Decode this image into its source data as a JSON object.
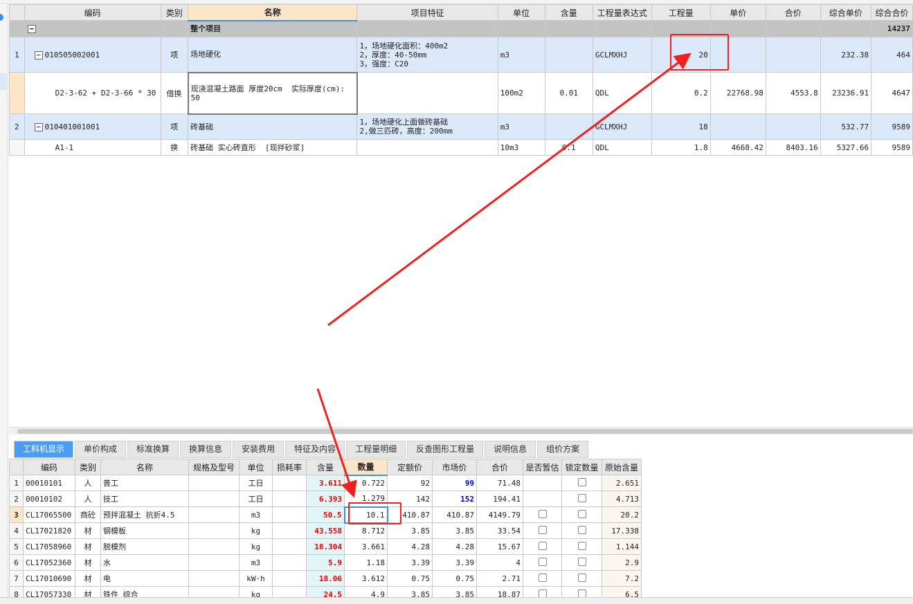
{
  "top_table": {
    "headers": [
      "编码",
      "类别",
      "名称",
      "项目特征",
      "单位",
      "含量",
      "工程量表达式",
      "工程量",
      "单价",
      "合价",
      "综合单价",
      "综合合价"
    ],
    "rows": [
      {
        "no": "",
        "code": "",
        "type": "",
        "name": "整个项目",
        "feature": "",
        "unit": "",
        "content": "",
        "expr": "",
        "qty": "",
        "price": "",
        "total": "",
        "comp_price": "",
        "comp_total": "14237",
        "style": "grey"
      },
      {
        "no": "1",
        "code": "010505002001",
        "type": "项",
        "name": "场地硬化",
        "feature": "1，场地硬化面积：400m2\n2，厚度：40-50mm\n3，强度：C20",
        "unit": "m3",
        "content": "",
        "expr": "GCLMXHJ",
        "qty": "20",
        "price": "",
        "total": "",
        "comp_price": "232.38",
        "comp_total": "464",
        "style": "blue"
      },
      {
        "no": "",
        "code": "D2-3-62 + D2-3-66 * 30",
        "type": "借换",
        "name": "现浇混凝土路面 厚度20cm  实际厚度(cm):\n50",
        "feature": "",
        "unit": "100m2",
        "content": "0.01",
        "expr": "QDL",
        "qty": "0.2",
        "price": "22768.98",
        "total": "4553.8",
        "comp_price": "23236.91",
        "comp_total": "4647",
        "style": "sub"
      },
      {
        "no": "2",
        "code": "010401001001",
        "type": "项",
        "name": "砖基础",
        "feature": "1，场地硬化上面做砖基础\n2,做三匹砖，高度：200mm",
        "unit": "m3",
        "content": "",
        "expr": "GCLMXHJ",
        "qty": "18",
        "price": "",
        "total": "",
        "comp_price": "532.77",
        "comp_total": "9589",
        "style": "blue"
      },
      {
        "no": "",
        "code": "A1-1",
        "type": "换",
        "name": "砖基础 实心砖直形  [现拌砂浆]",
        "feature": "",
        "unit": "10m3",
        "content": "0.1",
        "expr": "QDL",
        "qty": "1.8",
        "price": "4668.42",
        "total": "8403.16",
        "comp_price": "5327.66",
        "comp_total": "9589",
        "style": "sub"
      }
    ]
  },
  "tabs": [
    "工料机显示",
    "单价构成",
    "标准换算",
    "换算信息",
    "安装费用",
    "特征及内容",
    "工程量明细",
    "反查图形工程量",
    "说明信息",
    "组价方案"
  ],
  "bottom_table": {
    "headers": [
      "编码",
      "类别",
      "名称",
      "规格及型号",
      "单位",
      "损耗率",
      "含量",
      "数量",
      "定额价",
      "市场价",
      "合价",
      "是否暂估",
      "锁定数量",
      "原始含量"
    ],
    "rows": [
      {
        "no": "1",
        "code": "00010101",
        "type": "人",
        "name": "普工",
        "spec": "",
        "unit": "工日",
        "loss": "",
        "content": "3.611",
        "qty": "0.722",
        "base": "92",
        "market": "99",
        "total": "71.48",
        "est": false,
        "lock": true,
        "orig": "2.651",
        "market_hl": true
      },
      {
        "no": "2",
        "code": "00010102",
        "type": "人",
        "name": "技工",
        "spec": "",
        "unit": "工日",
        "loss": "",
        "content": "6.393",
        "qty": "1.279",
        "base": "142",
        "market": "152",
        "total": "194.41",
        "est": false,
        "lock": true,
        "orig": "4.713",
        "market_hl": true
      },
      {
        "no": "3",
        "code": "CL17065500",
        "type": "商砼",
        "name": "预拌混凝土 抗折4.5",
        "spec": "",
        "unit": "m3",
        "loss": "",
        "content": "50.5",
        "qty": "10.1",
        "base": "410.87",
        "market": "410.87",
        "total": "4149.79",
        "est": true,
        "lock": true,
        "orig": "20.2",
        "market_hl": false
      },
      {
        "no": "4",
        "code": "CL17021820",
        "type": "材",
        "name": "钢模板",
        "spec": "",
        "unit": "kg",
        "loss": "",
        "content": "43.558",
        "qty": "8.712",
        "base": "3.85",
        "market": "3.85",
        "total": "33.54",
        "est": true,
        "lock": true,
        "orig": "17.338",
        "market_hl": false
      },
      {
        "no": "5",
        "code": "CL17058960",
        "type": "材",
        "name": "脱模剂",
        "spec": "",
        "unit": "kg",
        "loss": "",
        "content": "18.304",
        "qty": "3.661",
        "base": "4.28",
        "market": "4.28",
        "total": "15.67",
        "est": true,
        "lock": true,
        "orig": "1.144",
        "market_hl": false
      },
      {
        "no": "6",
        "code": "CL17052360",
        "type": "材",
        "name": "水",
        "spec": "",
        "unit": "m3",
        "loss": "",
        "content": "5.9",
        "qty": "1.18",
        "base": "3.39",
        "market": "3.39",
        "total": "4",
        "est": true,
        "lock": true,
        "orig": "2.9",
        "market_hl": false
      },
      {
        "no": "7",
        "code": "CL17010690",
        "type": "材",
        "name": "电",
        "spec": "",
        "unit": "kW·h",
        "loss": "",
        "content": "18.06",
        "qty": "3.612",
        "base": "0.75",
        "market": "0.75",
        "total": "2.71",
        "est": true,
        "lock": true,
        "orig": "7.2",
        "market_hl": false
      },
      {
        "no": "8",
        "code": "CL17057330",
        "type": "材",
        "name": "铁件 综合",
        "spec": "",
        "unit": "kg",
        "loss": "",
        "content": "24.5",
        "qty": "4.9",
        "base": "3.85",
        "market": "3.85",
        "total": "18.87",
        "est": true,
        "lock": true,
        "orig": "6.5",
        "market_hl": false
      }
    ]
  },
  "colors": {
    "annotation": "#f02020",
    "accent": "#4a9df0",
    "row_blue": "#dce9fb"
  }
}
